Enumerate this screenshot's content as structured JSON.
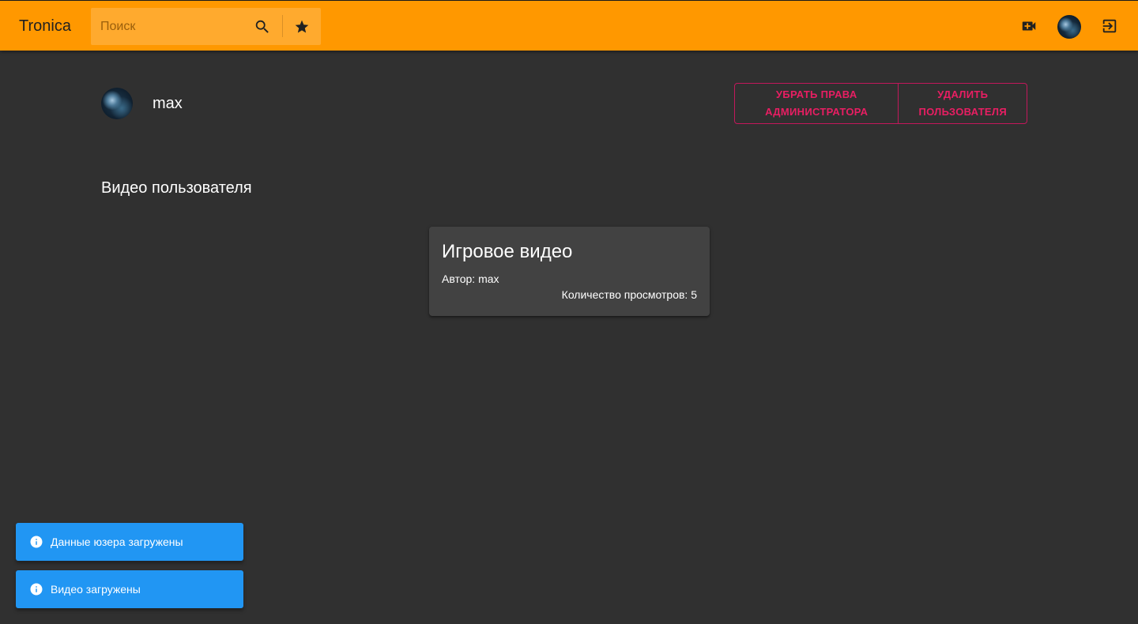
{
  "header": {
    "brand": "Tronica",
    "search": {
      "placeholder": "Поиск",
      "value": ""
    },
    "icons": {
      "search": "search-icon",
      "favorites": "star-icon",
      "upload": "video-plus-icon",
      "avatar": "user-avatar",
      "logout": "exit-icon"
    }
  },
  "profile": {
    "name": "max",
    "actions": {
      "remove_admin": "УБРАТЬ ПРАВА АДМИНИСТРАТОРА",
      "delete_user": "УДАЛИТЬ ПОЛЬЗОВАТЕЛЯ"
    }
  },
  "videos_section": {
    "title": "Видео пользователя",
    "items": [
      {
        "title": "Игровое видео",
        "author": "Автор: max",
        "views": "Количество просмотров: 5"
      }
    ]
  },
  "notifications": [
    {
      "text": "Данные юзера загружены",
      "icon": "info-icon"
    },
    {
      "text": "Видео загружены",
      "icon": "info-icon"
    }
  ],
  "colors": {
    "app_bar": "#ff9800",
    "background": "#303030",
    "card": "#424242",
    "danger": "#e91e63",
    "notification": "#2196f3"
  }
}
